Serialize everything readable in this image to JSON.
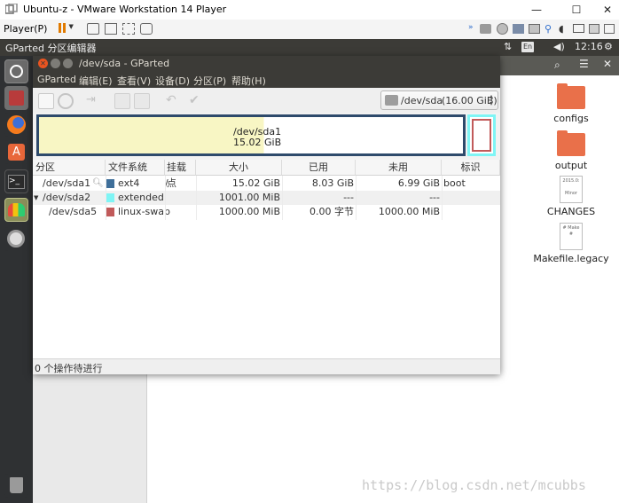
{
  "vmware": {
    "window_title": "Ubuntu-z - VMware Workstation 14 Player",
    "player_menu": "Player(P)",
    "window_controls": {
      "minimize": "—",
      "maximize": "☐",
      "close": "✕"
    }
  },
  "ubuntu_panel": {
    "app_title": "GParted 分区编辑器",
    "keyboard": "En",
    "clock": "12:16"
  },
  "gparted": {
    "window_title": "/dev/sda - GParted",
    "menus": [
      "GParted",
      "编辑(E)",
      "查看(V)",
      "设备(D)",
      "分区(P)",
      "帮助(H)"
    ],
    "device": "/dev/sda",
    "device_size": "(16.00 GiB)",
    "graph": {
      "name": "/dev/sda1",
      "size": "15.02 GiB"
    },
    "columns": [
      "分区",
      "文件系统",
      "挂载点",
      "大小",
      "已用",
      "未用",
      "标识"
    ],
    "rows": [
      {
        "partition": "/dev/sda1",
        "filesystem": "ext4",
        "fs_color": "#3f6f9a",
        "mount": "/",
        "size": "15.02 GiB",
        "used": "8.03 GiB",
        "unused": "6.99 GiB",
        "flags": "boot"
      },
      {
        "partition": "/dev/sda2",
        "filesystem": "extended",
        "fs_color": "#7ff5f5",
        "mount": "",
        "size": "1001.00 MiB",
        "used": "---",
        "unused": "---",
        "flags": ""
      },
      {
        "partition": "/dev/sda5",
        "filesystem": "linux-swap",
        "fs_color": "#c15a5a",
        "mount": "",
        "size": "1000.00 MiB",
        "used": "0.00 字节",
        "unused": "1000.00 MiB",
        "flags": ""
      }
    ],
    "status": "0 个操作待进行"
  },
  "desktop": {
    "items": [
      {
        "label": "configs",
        "icon": "folder-icon"
      },
      {
        "label": "output",
        "icon": "folder-icon"
      },
      {
        "label": "CHANGES",
        "icon": "text-file-icon",
        "preview": "2015.0:\n\nMinor"
      },
      {
        "label": "Makefile.legacy",
        "icon": "text-file-icon",
        "preview": "# Make\n#"
      }
    ]
  },
  "watermark": "https://blog.csdn.net/mcubbs",
  "colors": {
    "selection_orange": "#e95420",
    "graph_used": "#f8f6c4",
    "graph_border": "#2e4a6b"
  }
}
